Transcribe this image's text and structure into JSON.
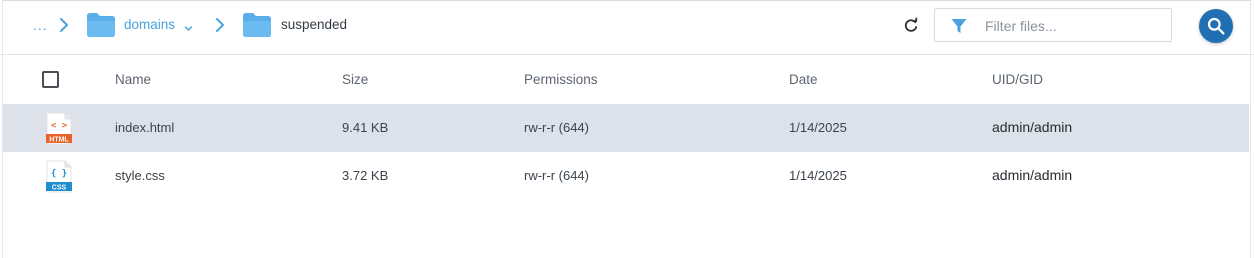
{
  "breadcrumb": {
    "ellipsis": "...",
    "items": [
      {
        "label": "domains",
        "has_dropdown": true,
        "color": "#4aa3df"
      },
      {
        "label": "suspended",
        "has_dropdown": false
      }
    ]
  },
  "toolbar": {
    "refresh_icon": "refresh-icon",
    "filter": {
      "placeholder": "Filter files...",
      "value": "",
      "icon": "filter-icon"
    },
    "search_button_icon": "search-icon",
    "accent": "#1f6fb2"
  },
  "table": {
    "columns": [
      "Name",
      "Size",
      "Permissions",
      "Date",
      "UID/GID"
    ],
    "rows": [
      {
        "icon": "html-file-icon",
        "icon_label": "HTML",
        "icon_glyph": "< >",
        "name": "index.html",
        "size": "9.41 KB",
        "permissions": "rw-r-r (644)",
        "date": "1/14/2025",
        "owner": "admin/admin",
        "selected": true
      },
      {
        "icon": "css-file-icon",
        "icon_label": "CSS",
        "icon_glyph": "{ }",
        "name": "style.css",
        "size": "3.72 KB",
        "permissions": "rw-r-r (644)",
        "date": "1/14/2025",
        "owner": "admin/admin",
        "selected": false
      }
    ]
  },
  "colors": {
    "selected_row": "#dde2ea",
    "folder": "#5aaeea",
    "html_badge": "#e8642c",
    "css_badge": "#1f8fd2"
  }
}
